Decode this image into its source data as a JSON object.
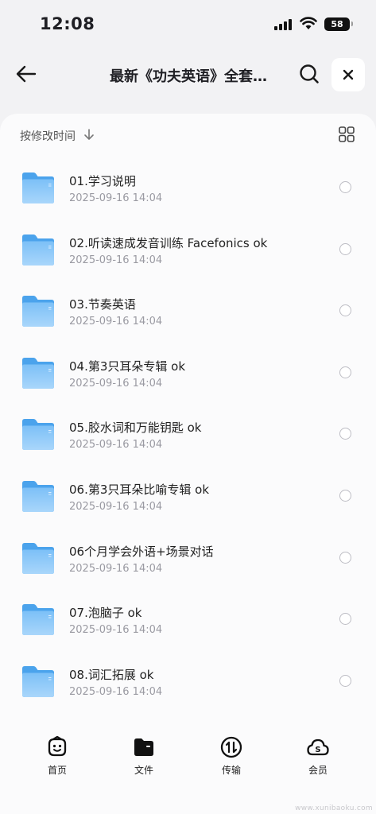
{
  "status_bar": {
    "time": "12:08",
    "battery": "58"
  },
  "header": {
    "title": "最新《功夫英语》全套…"
  },
  "sort": {
    "label": "按修改时间"
  },
  "files": [
    {
      "name": "01.学习说明",
      "date": "2025-09-16 14:04"
    },
    {
      "name": "02.听读速成发音训练 Facefonics  ok",
      "date": "2025-09-16 14:04"
    },
    {
      "name": "03.节奏英语",
      "date": "2025-09-16 14:04"
    },
    {
      "name": "04.第3只耳朵专辑 ok",
      "date": "2025-09-16 14:04"
    },
    {
      "name": "05.胶水词和万能钥匙 ok",
      "date": "2025-09-16 14:04"
    },
    {
      "name": "06.第3只耳朵比喻专辑  ok",
      "date": "2025-09-16 14:04"
    },
    {
      "name": "06个月学会外语+场景对话",
      "date": "2025-09-16 14:04"
    },
    {
      "name": "07.泡脑子 ok",
      "date": "2025-09-16 14:04"
    },
    {
      "name": "08.词汇拓展 ok",
      "date": "2025-09-16 14:04"
    }
  ],
  "tabs": [
    {
      "label": "首页",
      "icon": "home-face-icon"
    },
    {
      "label": "文件",
      "icon": "folder-filled-icon"
    },
    {
      "label": "传输",
      "icon": "transfer-icon"
    },
    {
      "label": "会员",
      "icon": "vip-cloud-icon"
    }
  ],
  "watermark": "www.xunibaoku.com"
}
